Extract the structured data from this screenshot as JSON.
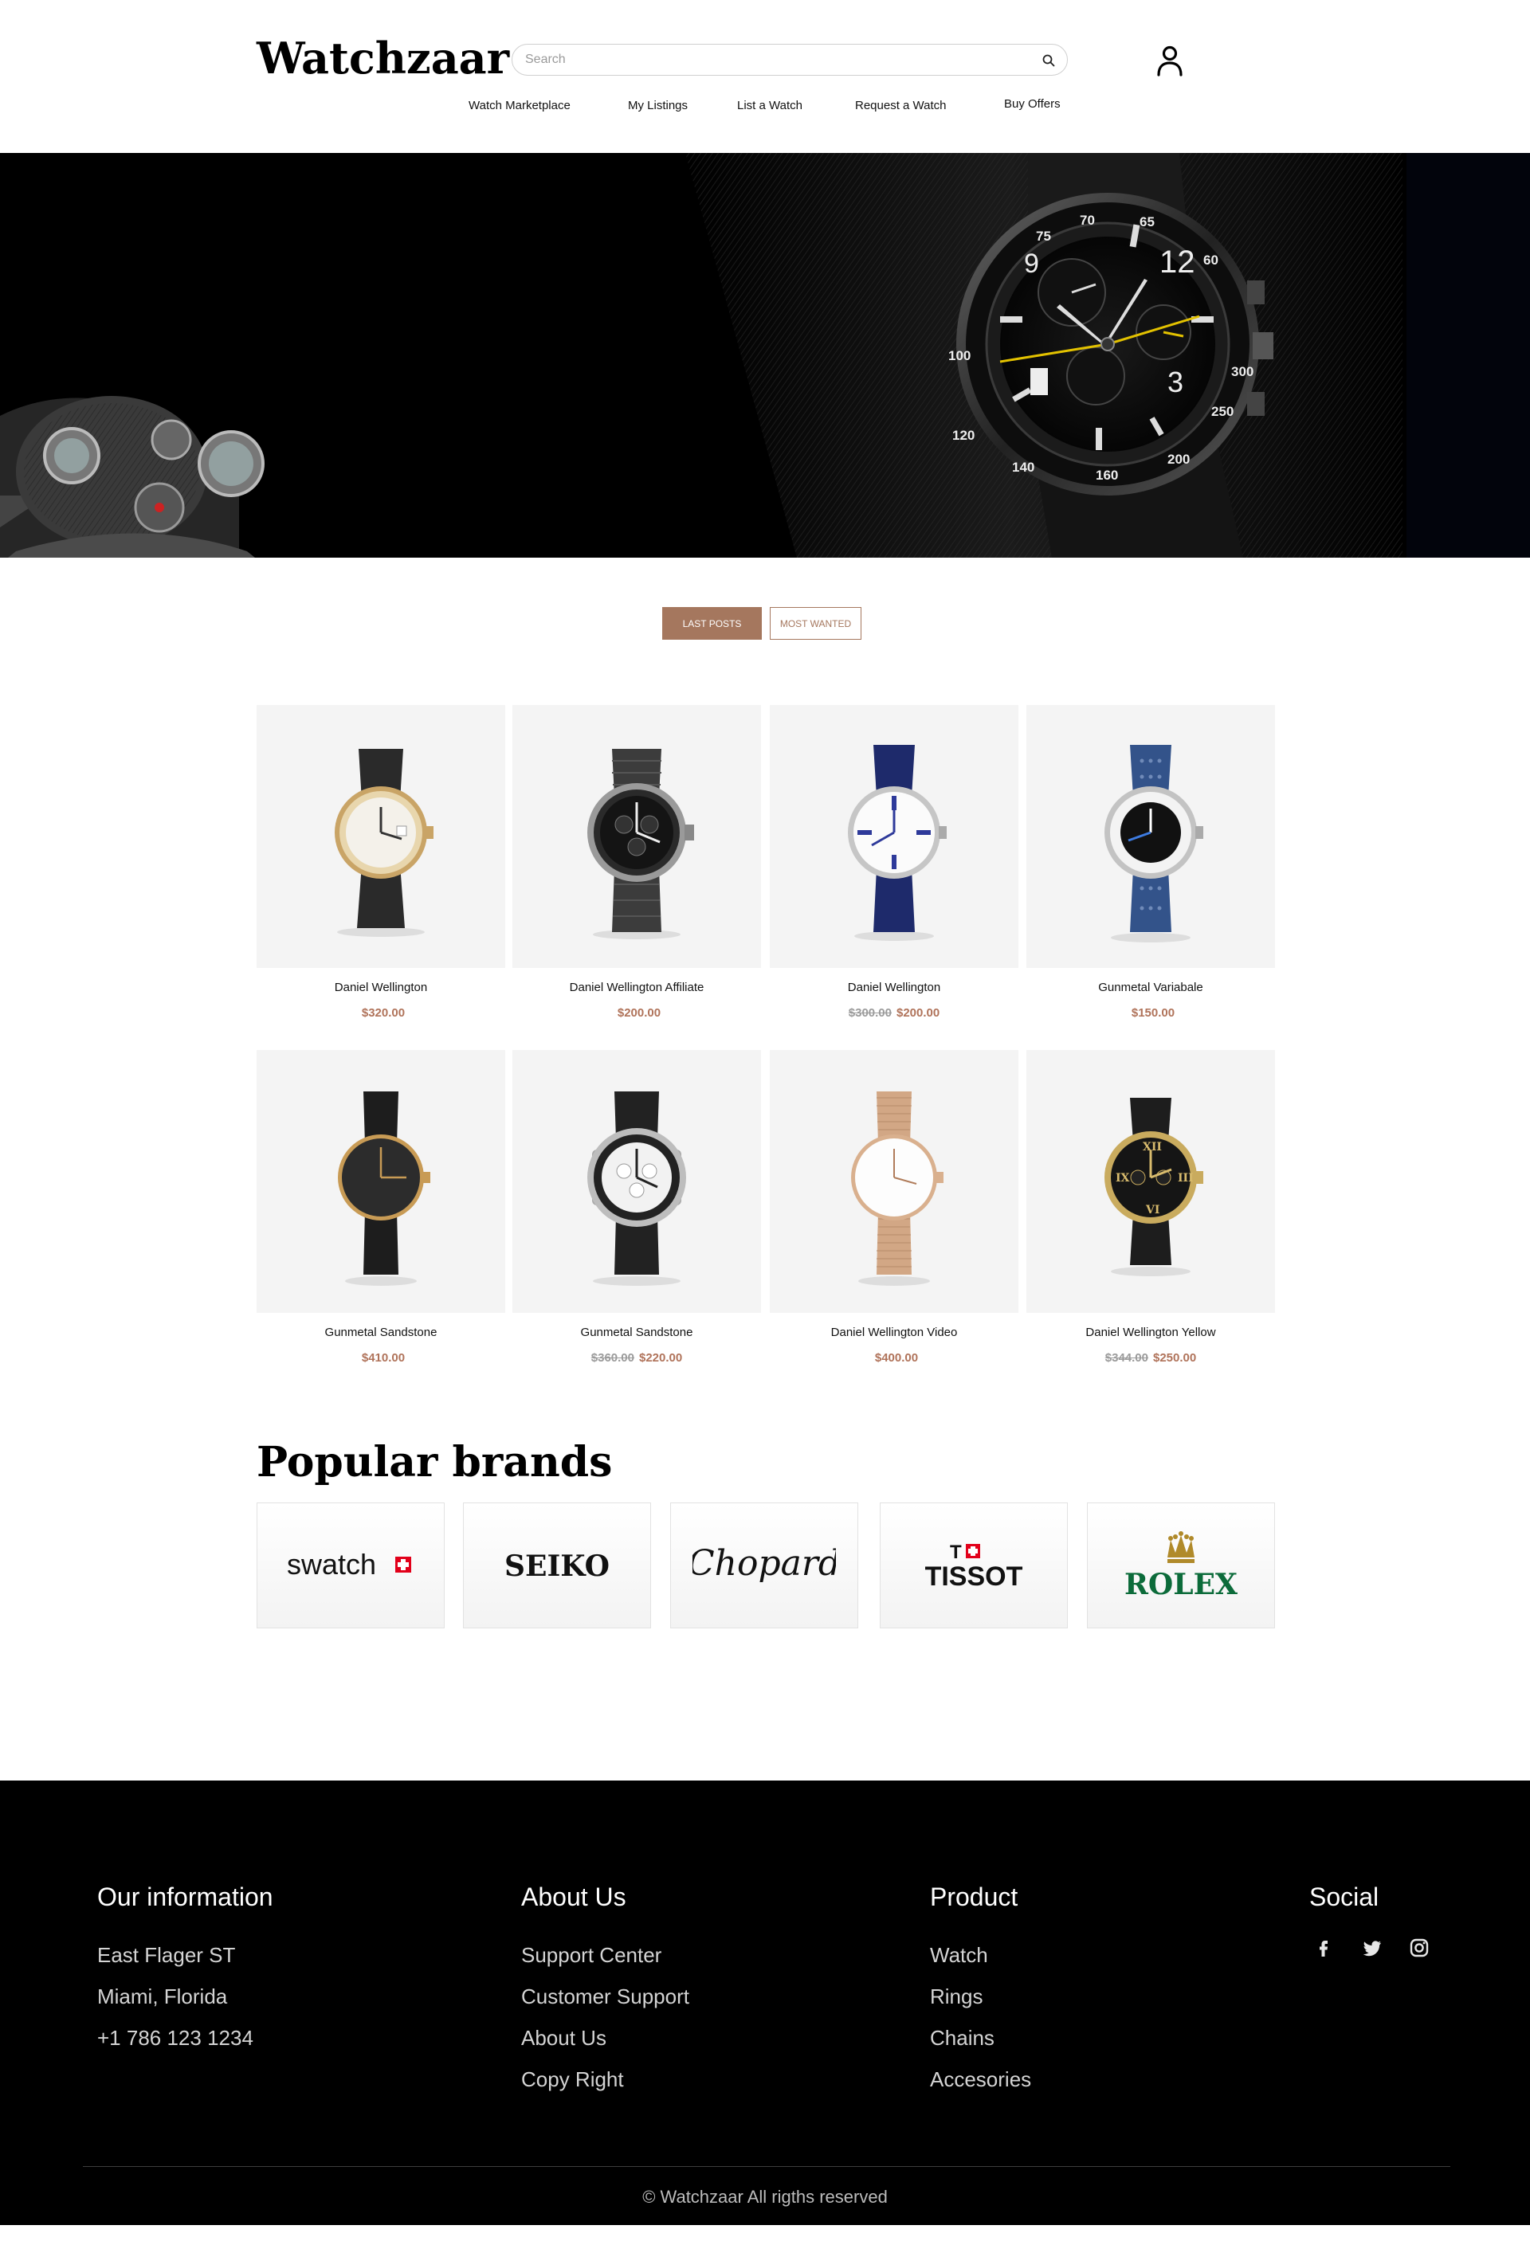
{
  "header": {
    "logo": "Watchzaar",
    "search": {
      "placeholder": "Search",
      "icon": "search-icon"
    },
    "account_icon": "user-icon",
    "nav": [
      {
        "label": "Watch Marketplace"
      },
      {
        "label": "My Listings"
      },
      {
        "label": "List a Watch"
      },
      {
        "label": "Request a Watch"
      },
      {
        "label": "Buy Offers"
      }
    ]
  },
  "tabs": [
    {
      "label": "LAST POSTS",
      "active": true
    },
    {
      "label": "MOST WANTED",
      "active": false
    }
  ],
  "products": [
    {
      "name": "Daniel Wellington",
      "old_price": "",
      "price": "$320.00",
      "image": "gold-leather-watch"
    },
    {
      "name": "Daniel Wellington Affiliate",
      "old_price": "",
      "price": "$200.00",
      "image": "black-chronograph-steel-watch"
    },
    {
      "name": "Daniel Wellington",
      "old_price": "$300.00",
      "price": "$200.00",
      "image": "blue-leather-roman-watch"
    },
    {
      "name": "Gunmetal Variabale",
      "old_price": "",
      "price": "$150.00",
      "image": "blue-perforated-strap-watch"
    },
    {
      "name": "Gunmetal Sandstone",
      "old_price": "",
      "price": "$410.00",
      "image": "black-minimal-gold-watch"
    },
    {
      "name": "Gunmetal Sandstone",
      "old_price": "$360.00",
      "price": "$220.00",
      "image": "silver-chronograph-watch"
    },
    {
      "name": "Daniel Wellington Video",
      "old_price": "",
      "price": "$400.00",
      "image": "rose-gold-mesh-watch"
    },
    {
      "name": "Daniel Wellington Yellow",
      "old_price": "$344.00",
      "price": "$250.00",
      "image": "gold-black-roman-watch"
    }
  ],
  "brands": {
    "title": "Popular brands",
    "items": [
      {
        "name": "swatch",
        "logo": "swatch-logo"
      },
      {
        "name": "SEIKO",
        "logo": "seiko-logo"
      },
      {
        "name": "Chopard",
        "logo": "chopard-logo"
      },
      {
        "name": "TISSOT",
        "logo": "tissot-logo"
      },
      {
        "name": "ROLEX",
        "logo": "rolex-logo"
      }
    ]
  },
  "footer": {
    "info": {
      "heading": "Our information",
      "lines": [
        "East Flager ST",
        "Miami, Florida",
        "+1 786 123 1234"
      ]
    },
    "about": {
      "heading": "About Us",
      "links": [
        "Support Center",
        "Customer Support",
        "About Us",
        "Copy Right"
      ]
    },
    "product": {
      "heading": "Product",
      "links": [
        "Watch",
        "Rings",
        "Chains",
        "Accesories"
      ]
    },
    "social": {
      "heading": "Social",
      "icons": [
        "facebook-icon",
        "twitter-icon",
        "instagram-icon"
      ]
    },
    "copyright": "© Watchzaar All rigths reserved"
  },
  "colors": {
    "accent": "#a5775e",
    "price": "#b0735a",
    "footer_bg": "#000000",
    "hero_bg": "#000000"
  }
}
